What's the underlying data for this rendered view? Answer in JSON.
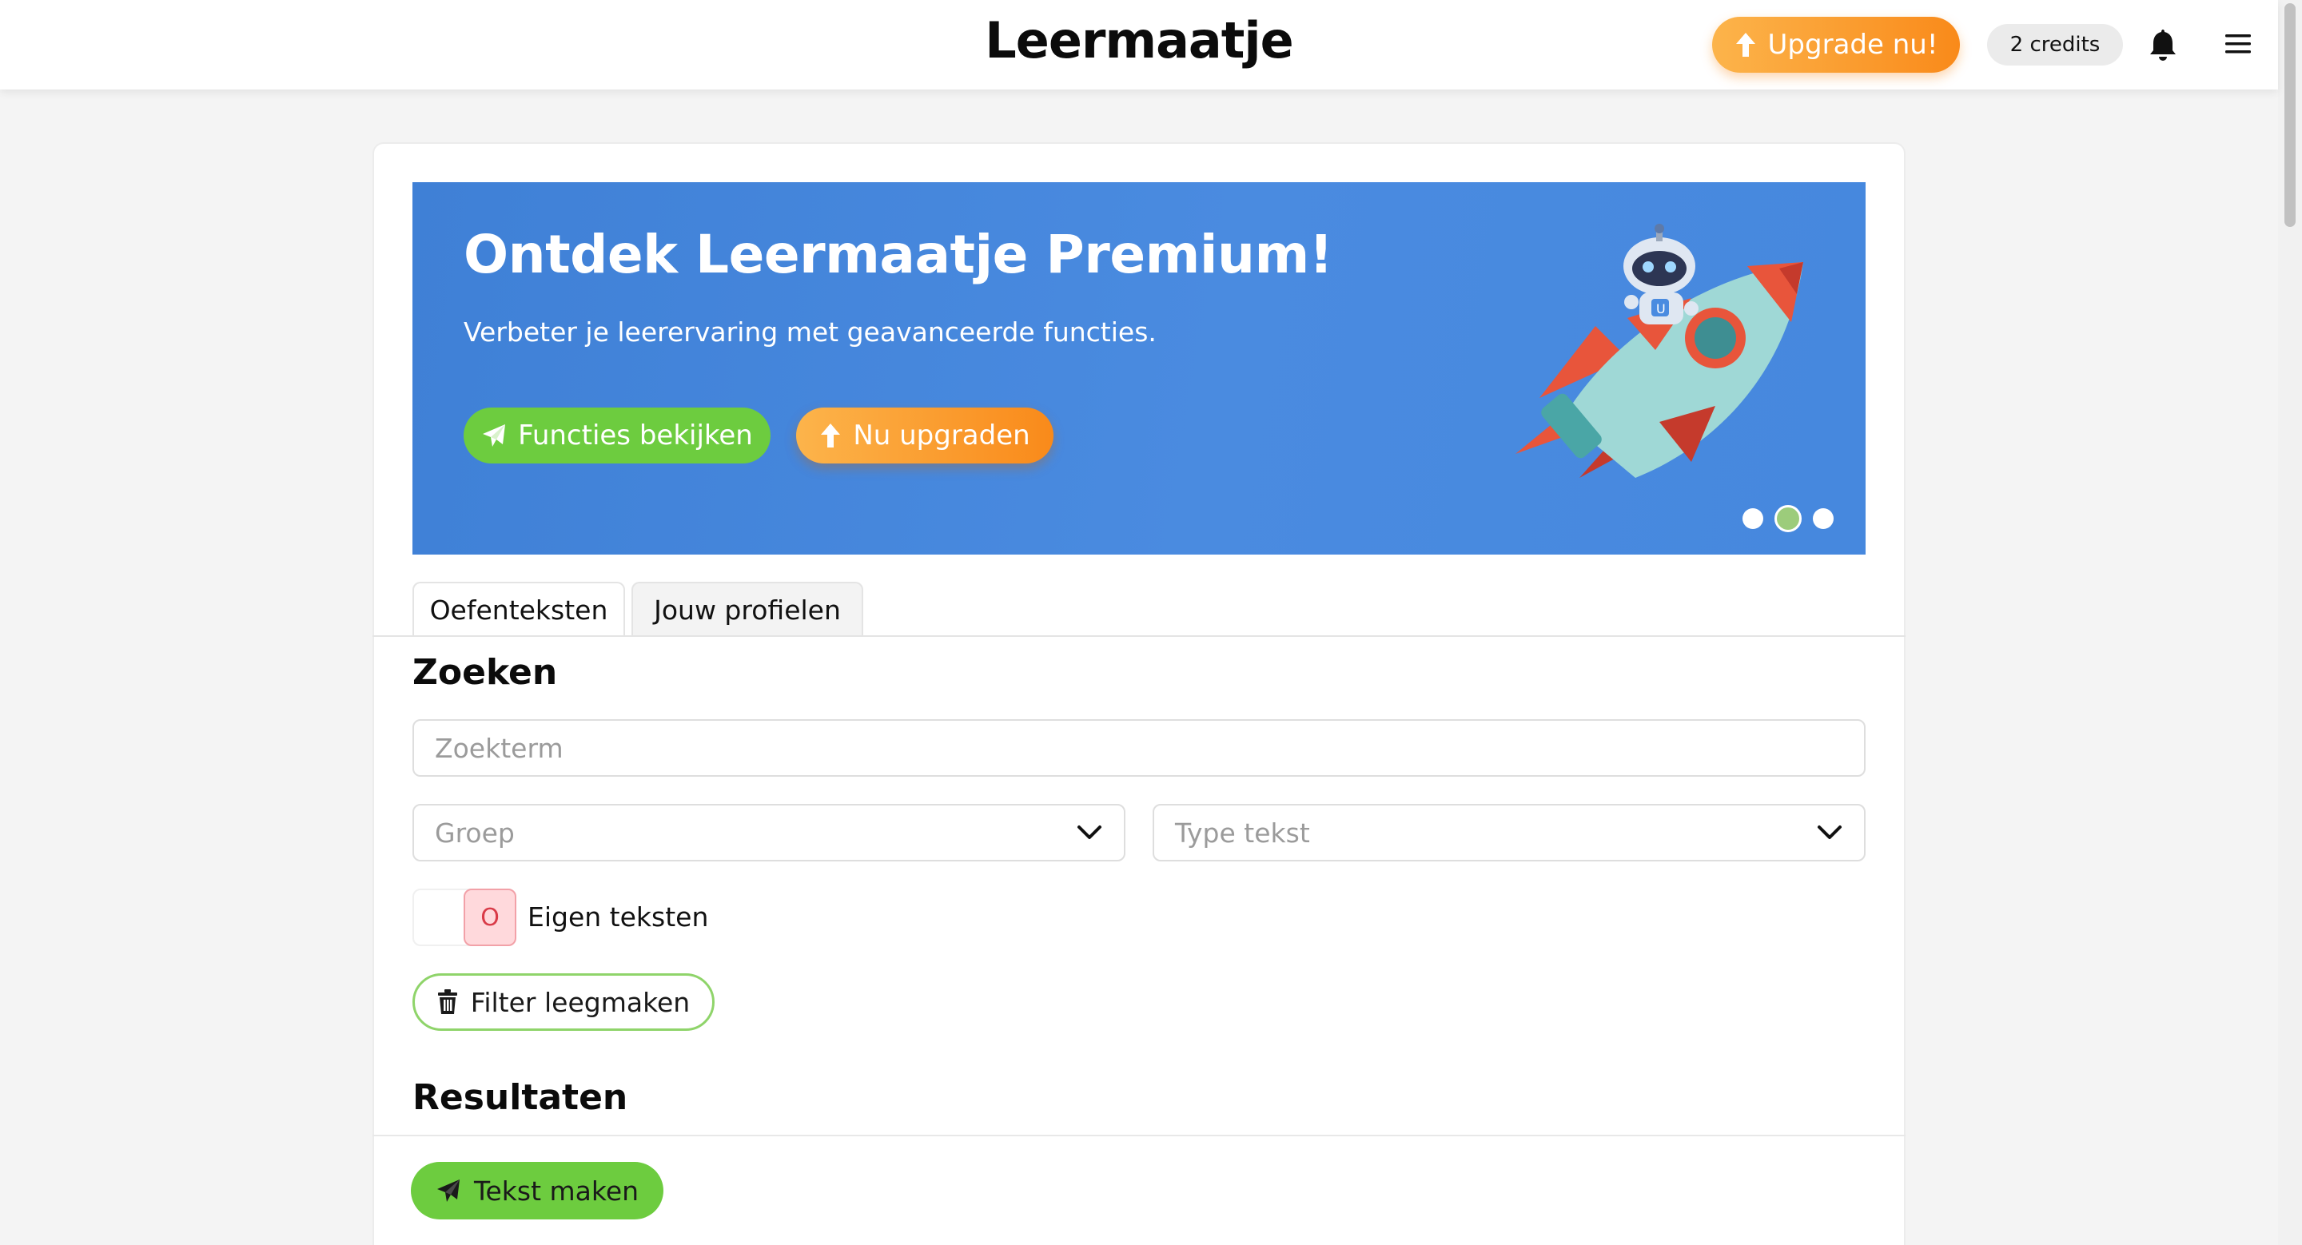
{
  "header": {
    "brand": "Leermaatje",
    "upgrade_label": "Upgrade nu!",
    "credits_label": "2 credits",
    "icons": [
      "arrow-up-icon",
      "bell-icon",
      "hamburger-menu-icon"
    ]
  },
  "banner": {
    "title": "Ontdek Leermaatje Premium!",
    "subtitle": "Verbeter je leerervaring met geavanceerde functies.",
    "primary_button": "Functies bekijken",
    "secondary_button": "Nu upgraden",
    "slides_total": 3,
    "active_slide": 2,
    "background_color": "#4688de",
    "illustration": "robot-riding-rocket"
  },
  "tabs": [
    {
      "label": "Oefenteksten",
      "active": true
    },
    {
      "label": "Jouw profielen",
      "active": false
    }
  ],
  "search": {
    "heading": "Zoeken",
    "search_placeholder": "Zoekterm",
    "group_placeholder": "Groep",
    "type_placeholder": "Type tekst",
    "own_texts_label": "Eigen teksten",
    "own_texts_on": false,
    "toggle_symbol": "O",
    "clear_button": "Filter leegmaken"
  },
  "results": {
    "heading": "Resultaten",
    "create_button": "Tekst maken"
  },
  "colors": {
    "accent_green": "#6dcc3f",
    "accent_orange": "#f98a1a",
    "banner_blue": "#4688de",
    "toggle_off_pink": "#ffd9dc"
  }
}
